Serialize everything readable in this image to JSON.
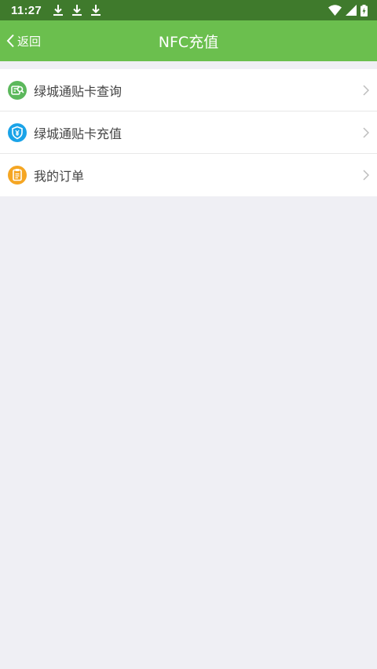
{
  "status_bar": {
    "time": "11:27",
    "download_icons": [
      "download-icon",
      "download-icon",
      "download-icon"
    ],
    "right_icons": [
      "wifi-icon",
      "signal-icon",
      "battery-charging-icon"
    ]
  },
  "header": {
    "back_label": "返回",
    "title": "NFC充值",
    "background": "#6bbf4e"
  },
  "menu": {
    "items": [
      {
        "label": "绿城通贴卡查询",
        "icon": "card-search-icon",
        "icon_color": "#5cb85c"
      },
      {
        "label": "绿城通贴卡充值",
        "icon": "shield-yen-icon",
        "icon_color": "#1aa3e8"
      },
      {
        "label": "我的订单",
        "icon": "order-clipboard-icon",
        "icon_color": "#f5a623"
      }
    ]
  }
}
